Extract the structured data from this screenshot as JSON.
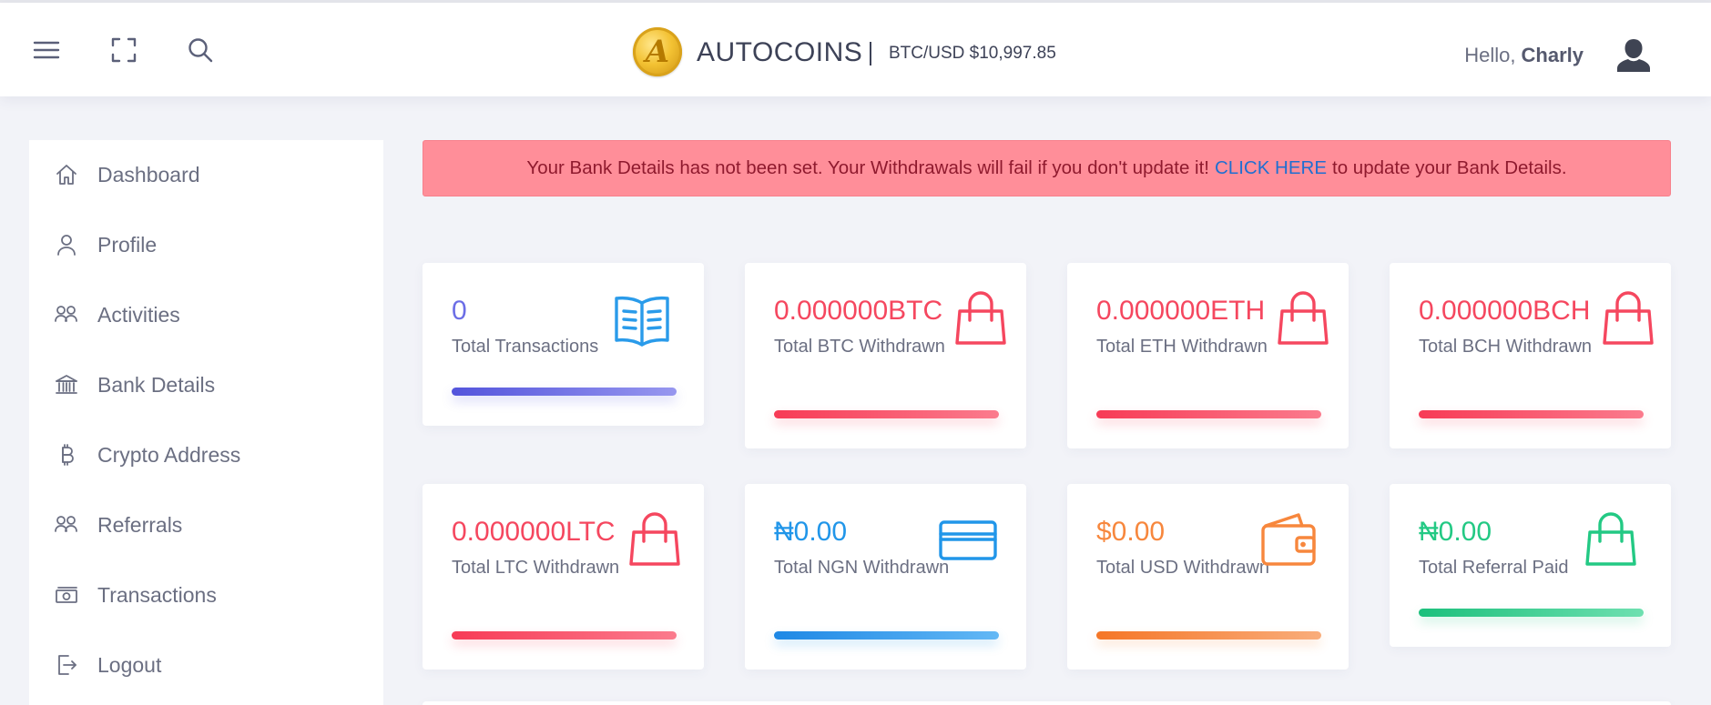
{
  "header": {
    "brand": "AUTOCOINS",
    "btc_rate": "BTC/USD $10,997.85",
    "greeting": "Hello,",
    "username": "Charly",
    "icons": [
      "menu-icon",
      "fullscreen-icon",
      "search-icon",
      "user-avatar-icon"
    ]
  },
  "sidebar": {
    "items": [
      {
        "label": "Dashboard",
        "icon": "home-icon"
      },
      {
        "label": "Profile",
        "icon": "user-icon"
      },
      {
        "label": "Activities",
        "icon": "users-icon"
      },
      {
        "label": "Bank Details",
        "icon": "bank-icon"
      },
      {
        "label": "Crypto Address",
        "icon": "bitcoin-icon"
      },
      {
        "label": "Referrals",
        "icon": "users-icon"
      },
      {
        "label": "Transactions",
        "icon": "money-icon"
      },
      {
        "label": "Logout",
        "icon": "logout-icon"
      }
    ]
  },
  "alert": {
    "before": "Your Bank Details has not been set. Your Withdrawals will fail if you don't update it!",
    "link": "CLICK HERE",
    "after": "to update your Bank Details."
  },
  "cards": [
    {
      "value": "0",
      "label": "Total Transactions",
      "icon": "book-icon",
      "color": "#6c6ee6"
    },
    {
      "value": "0.000000BTC",
      "label": "Total BTC Withdrawn",
      "icon": "shopping-bag-icon",
      "color": "#f5475f"
    },
    {
      "value": "0.000000ETH",
      "label": "Total ETH Withdrawn",
      "icon": "shopping-bag-icon",
      "color": "#f5475f"
    },
    {
      "value": "0.000000BCH",
      "label": "Total BCH Withdrawn",
      "icon": "shopping-bag-icon",
      "color": "#f5475f"
    },
    {
      "value": "0.000000LTC",
      "label": "Total LTC Withdrawn",
      "icon": "shopping-bag-icon",
      "color": "#f5475f"
    },
    {
      "value": "₦0.00",
      "label": "Total NGN Withdrawn",
      "icon": "credit-card-icon",
      "color": "#2196e9"
    },
    {
      "value": "$0.00",
      "label": "Total USD Withdrawn",
      "icon": "wallet-icon",
      "color": "#f7873d"
    },
    {
      "value": "₦0.00",
      "label": "Total Referral Paid",
      "icon": "shopping-bag-icon",
      "color": "#23c984"
    }
  ],
  "colors": {
    "background": "#f2f3f8",
    "alert_bg": "#ff8e99",
    "alert_text": "#8f1a2e",
    "link": "#1f6fd1"
  }
}
